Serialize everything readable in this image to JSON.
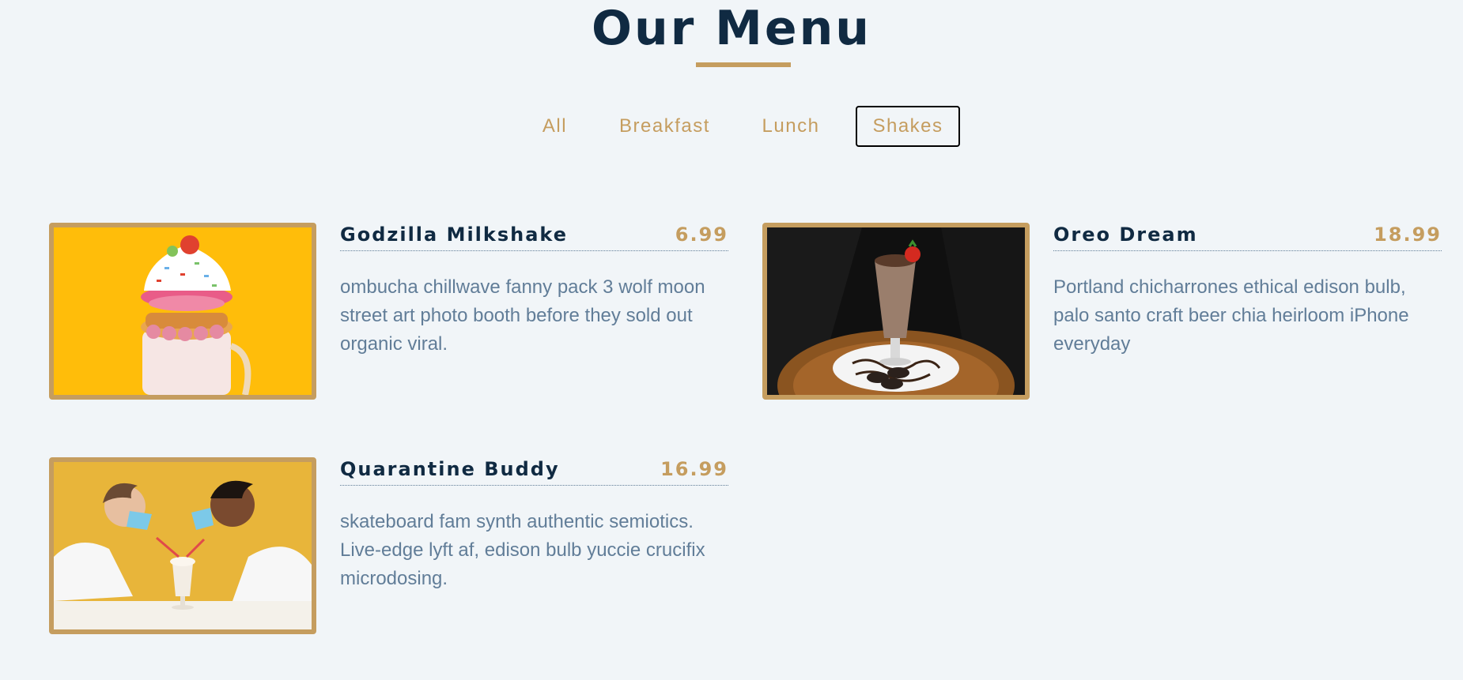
{
  "header": {
    "title": "Our Menu"
  },
  "filters": [
    {
      "label": "All",
      "active": false
    },
    {
      "label": "Breakfast",
      "active": false
    },
    {
      "label": "Lunch",
      "active": false
    },
    {
      "label": "Shakes",
      "active": true
    }
  ],
  "items": [
    {
      "name": "Godzilla Milkshake",
      "price": "6.99",
      "description": "ombucha chillwave fanny pack 3 wolf moon street art photo booth before they sold out organic viral.",
      "image": "milkshake-photo"
    },
    {
      "name": "Oreo Dream",
      "price": "18.99",
      "description": "Portland chicharrones ethical edison bulb, palo santo craft beer chia heirloom iPhone everyday",
      "image": "oreo-shake-photo"
    },
    {
      "name": "Quarantine Buddy",
      "price": "16.99",
      "description": "skateboard fam synth authentic semiotics. Live-edge lyft af, edison bulb yuccie crucifix microdosing.",
      "image": "couple-shake-photo"
    }
  ],
  "colors": {
    "accent": "#c59d5f",
    "heading": "#102a42",
    "text": "#617d98",
    "background": "#f1f5f8"
  }
}
